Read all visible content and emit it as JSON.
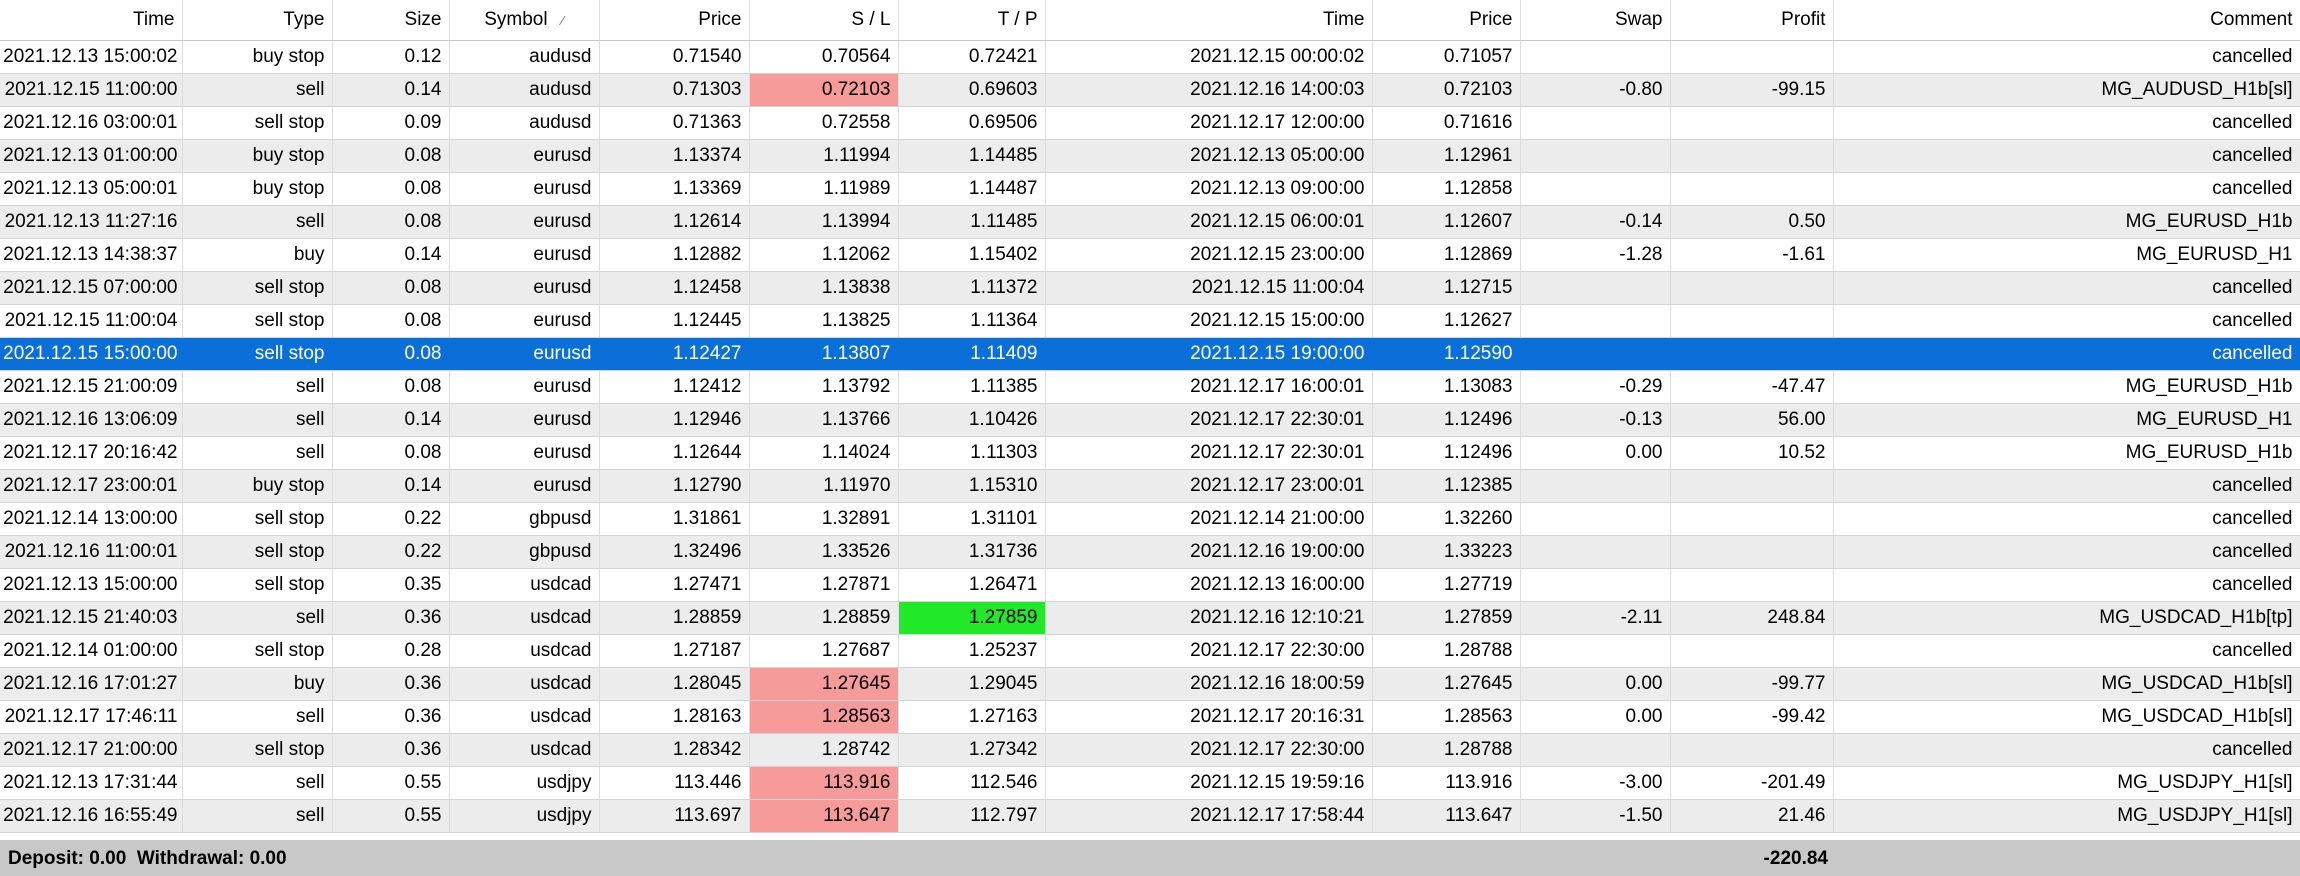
{
  "columns": [
    {
      "key": "open_time",
      "label": "Time"
    },
    {
      "key": "type",
      "label": "Type"
    },
    {
      "key": "size",
      "label": "Size"
    },
    {
      "key": "symbol",
      "label": "Symbol",
      "sort_icon": "sort-descending-icon",
      "sort_glyph": "⁄"
    },
    {
      "key": "open_price",
      "label": "Price"
    },
    {
      "key": "sl",
      "label": "S / L"
    },
    {
      "key": "tp",
      "label": "T / P"
    },
    {
      "key": "close_time",
      "label": "Time"
    },
    {
      "key": "close_price",
      "label": "Price"
    },
    {
      "key": "swap",
      "label": "Swap"
    },
    {
      "key": "profit",
      "label": "Profit"
    },
    {
      "key": "comment",
      "label": "Comment"
    }
  ],
  "rows": [
    {
      "open_time": "2021.12.13 15:00:02",
      "type": "buy stop",
      "size": "0.12",
      "symbol": "audusd",
      "open_price": "0.71540",
      "sl": "0.70564",
      "tp": "0.72421",
      "close_time": "2021.12.15 00:00:02",
      "close_price": "0.71057",
      "swap": "",
      "profit": "",
      "comment": "cancelled"
    },
    {
      "open_time": "2021.12.15 11:00:00",
      "type": "sell",
      "size": "0.14",
      "symbol": "audusd",
      "open_price": "0.71303",
      "sl": "0.72103",
      "tp": "0.69603",
      "close_time": "2021.12.16 14:00:03",
      "close_price": "0.72103",
      "swap": "-0.80",
      "profit": "-99.15",
      "comment": "MG_AUDUSD_H1b[sl]",
      "hit": "sl"
    },
    {
      "open_time": "2021.12.16 03:00:01",
      "type": "sell stop",
      "size": "0.09",
      "symbol": "audusd",
      "open_price": "0.71363",
      "sl": "0.72558",
      "tp": "0.69506",
      "close_time": "2021.12.17 12:00:00",
      "close_price": "0.71616",
      "swap": "",
      "profit": "",
      "comment": "cancelled"
    },
    {
      "open_time": "2021.12.13 01:00:00",
      "type": "buy stop",
      "size": "0.08",
      "symbol": "eurusd",
      "open_price": "1.13374",
      "sl": "1.11994",
      "tp": "1.14485",
      "close_time": "2021.12.13 05:00:00",
      "close_price": "1.12961",
      "swap": "",
      "profit": "",
      "comment": "cancelled"
    },
    {
      "open_time": "2021.12.13 05:00:01",
      "type": "buy stop",
      "size": "0.08",
      "symbol": "eurusd",
      "open_price": "1.13369",
      "sl": "1.11989",
      "tp": "1.14487",
      "close_time": "2021.12.13 09:00:00",
      "close_price": "1.12858",
      "swap": "",
      "profit": "",
      "comment": "cancelled"
    },
    {
      "open_time": "2021.12.13 11:27:16",
      "type": "sell",
      "size": "0.08",
      "symbol": "eurusd",
      "open_price": "1.12614",
      "sl": "1.13994",
      "tp": "1.11485",
      "close_time": "2021.12.15 06:00:01",
      "close_price": "1.12607",
      "swap": "-0.14",
      "profit": "0.50",
      "comment": "MG_EURUSD_H1b"
    },
    {
      "open_time": "2021.12.13 14:38:37",
      "type": "buy",
      "size": "0.14",
      "symbol": "eurusd",
      "open_price": "1.12882",
      "sl": "1.12062",
      "tp": "1.15402",
      "close_time": "2021.12.15 23:00:00",
      "close_price": "1.12869",
      "swap": "-1.28",
      "profit": "-1.61",
      "comment": "MG_EURUSD_H1"
    },
    {
      "open_time": "2021.12.15 07:00:00",
      "type": "sell stop",
      "size": "0.08",
      "symbol": "eurusd",
      "open_price": "1.12458",
      "sl": "1.13838",
      "tp": "1.11372",
      "close_time": "2021.12.15 11:00:04",
      "close_price": "1.12715",
      "swap": "",
      "profit": "",
      "comment": "cancelled"
    },
    {
      "open_time": "2021.12.15 11:00:04",
      "type": "sell stop",
      "size": "0.08",
      "symbol": "eurusd",
      "open_price": "1.12445",
      "sl": "1.13825",
      "tp": "1.11364",
      "close_time": "2021.12.15 15:00:00",
      "close_price": "1.12627",
      "swap": "",
      "profit": "",
      "comment": "cancelled"
    },
    {
      "open_time": "2021.12.15 15:00:00",
      "type": "sell stop",
      "size": "0.08",
      "symbol": "eurusd",
      "open_price": "1.12427",
      "sl": "1.13807",
      "tp": "1.11409",
      "close_time": "2021.12.15 19:00:00",
      "close_price": "1.12590",
      "swap": "",
      "profit": "",
      "comment": "cancelled",
      "selected": true
    },
    {
      "open_time": "2021.12.15 21:00:09",
      "type": "sell",
      "size": "0.08",
      "symbol": "eurusd",
      "open_price": "1.12412",
      "sl": "1.13792",
      "tp": "1.11385",
      "close_time": "2021.12.17 16:00:01",
      "close_price": "1.13083",
      "swap": "-0.29",
      "profit": "-47.47",
      "comment": "MG_EURUSD_H1b"
    },
    {
      "open_time": "2021.12.16 13:06:09",
      "type": "sell",
      "size": "0.14",
      "symbol": "eurusd",
      "open_price": "1.12946",
      "sl": "1.13766",
      "tp": "1.10426",
      "close_time": "2021.12.17 22:30:01",
      "close_price": "1.12496",
      "swap": "-0.13",
      "profit": "56.00",
      "comment": "MG_EURUSD_H1"
    },
    {
      "open_time": "2021.12.17 20:16:42",
      "type": "sell",
      "size": "0.08",
      "symbol": "eurusd",
      "open_price": "1.12644",
      "sl": "1.14024",
      "tp": "1.11303",
      "close_time": "2021.12.17 22:30:01",
      "close_price": "1.12496",
      "swap": "0.00",
      "profit": "10.52",
      "comment": "MG_EURUSD_H1b"
    },
    {
      "open_time": "2021.12.17 23:00:01",
      "type": "buy stop",
      "size": "0.14",
      "symbol": "eurusd",
      "open_price": "1.12790",
      "sl": "1.11970",
      "tp": "1.15310",
      "close_time": "2021.12.17 23:00:01",
      "close_price": "1.12385",
      "swap": "",
      "profit": "",
      "comment": "cancelled"
    },
    {
      "open_time": "2021.12.14 13:00:00",
      "type": "sell stop",
      "size": "0.22",
      "symbol": "gbpusd",
      "open_price": "1.31861",
      "sl": "1.32891",
      "tp": "1.31101",
      "close_time": "2021.12.14 21:00:00",
      "close_price": "1.32260",
      "swap": "",
      "profit": "",
      "comment": "cancelled"
    },
    {
      "open_time": "2021.12.16 11:00:01",
      "type": "sell stop",
      "size": "0.22",
      "symbol": "gbpusd",
      "open_price": "1.32496",
      "sl": "1.33526",
      "tp": "1.31736",
      "close_time": "2021.12.16 19:00:00",
      "close_price": "1.33223",
      "swap": "",
      "profit": "",
      "comment": "cancelled"
    },
    {
      "open_time": "2021.12.13 15:00:00",
      "type": "sell stop",
      "size": "0.35",
      "symbol": "usdcad",
      "open_price": "1.27471",
      "sl": "1.27871",
      "tp": "1.26471",
      "close_time": "2021.12.13 16:00:00",
      "close_price": "1.27719",
      "swap": "",
      "profit": "",
      "comment": "cancelled"
    },
    {
      "open_time": "2021.12.15 21:40:03",
      "type": "sell",
      "size": "0.36",
      "symbol": "usdcad",
      "open_price": "1.28859",
      "sl": "1.28859",
      "tp": "1.27859",
      "close_time": "2021.12.16 12:10:21",
      "close_price": "1.27859",
      "swap": "-2.11",
      "profit": "248.84",
      "comment": "MG_USDCAD_H1b[tp]",
      "hit": "tp"
    },
    {
      "open_time": "2021.12.14 01:00:00",
      "type": "sell stop",
      "size": "0.28",
      "symbol": "usdcad",
      "open_price": "1.27187",
      "sl": "1.27687",
      "tp": "1.25237",
      "close_time": "2021.12.17 22:30:00",
      "close_price": "1.28788",
      "swap": "",
      "profit": "",
      "comment": "cancelled"
    },
    {
      "open_time": "2021.12.16 17:01:27",
      "type": "buy",
      "size": "0.36",
      "symbol": "usdcad",
      "open_price": "1.28045",
      "sl": "1.27645",
      "tp": "1.29045",
      "close_time": "2021.12.16 18:00:59",
      "close_price": "1.27645",
      "swap": "0.00",
      "profit": "-99.77",
      "comment": "MG_USDCAD_H1b[sl]",
      "hit": "sl"
    },
    {
      "open_time": "2021.12.17 17:46:11",
      "type": "sell",
      "size": "0.36",
      "symbol": "usdcad",
      "open_price": "1.28163",
      "sl": "1.28563",
      "tp": "1.27163",
      "close_time": "2021.12.17 20:16:31",
      "close_price": "1.28563",
      "swap": "0.00",
      "profit": "-99.42",
      "comment": "MG_USDCAD_H1b[sl]",
      "hit": "sl"
    },
    {
      "open_time": "2021.12.17 21:00:00",
      "type": "sell stop",
      "size": "0.36",
      "symbol": "usdcad",
      "open_price": "1.28342",
      "sl": "1.28742",
      "tp": "1.27342",
      "close_time": "2021.12.17 22:30:00",
      "close_price": "1.28788",
      "swap": "",
      "profit": "",
      "comment": "cancelled"
    },
    {
      "open_time": "2021.12.13 17:31:44",
      "type": "sell",
      "size": "0.55",
      "symbol": "usdjpy",
      "open_price": "113.446",
      "sl": "113.916",
      "tp": "112.546",
      "close_time": "2021.12.15 19:59:16",
      "close_price": "113.916",
      "swap": "-3.00",
      "profit": "-201.49",
      "comment": "MG_USDJPY_H1[sl]",
      "hit": "sl"
    },
    {
      "open_time": "2021.12.16 16:55:49",
      "type": "sell",
      "size": "0.55",
      "symbol": "usdjpy",
      "open_price": "113.697",
      "sl": "113.647",
      "tp": "112.797",
      "close_time": "2021.12.17 17:58:44",
      "close_price": "113.647",
      "swap": "-1.50",
      "profit": "21.46",
      "comment": "MG_USDJPY_H1[sl]",
      "hit": "sl"
    }
  ],
  "footer": {
    "summary": "Deposit: 0.00  Withdrawal: 0.00",
    "total_profit": "-220.84"
  },
  "colors": {
    "selected_row": "#0a6fd9",
    "sl_hit": "#f79a9a",
    "tp_hit": "#22e82a",
    "alt_row": "#ececec",
    "footer_bg": "#c8c8c8"
  }
}
